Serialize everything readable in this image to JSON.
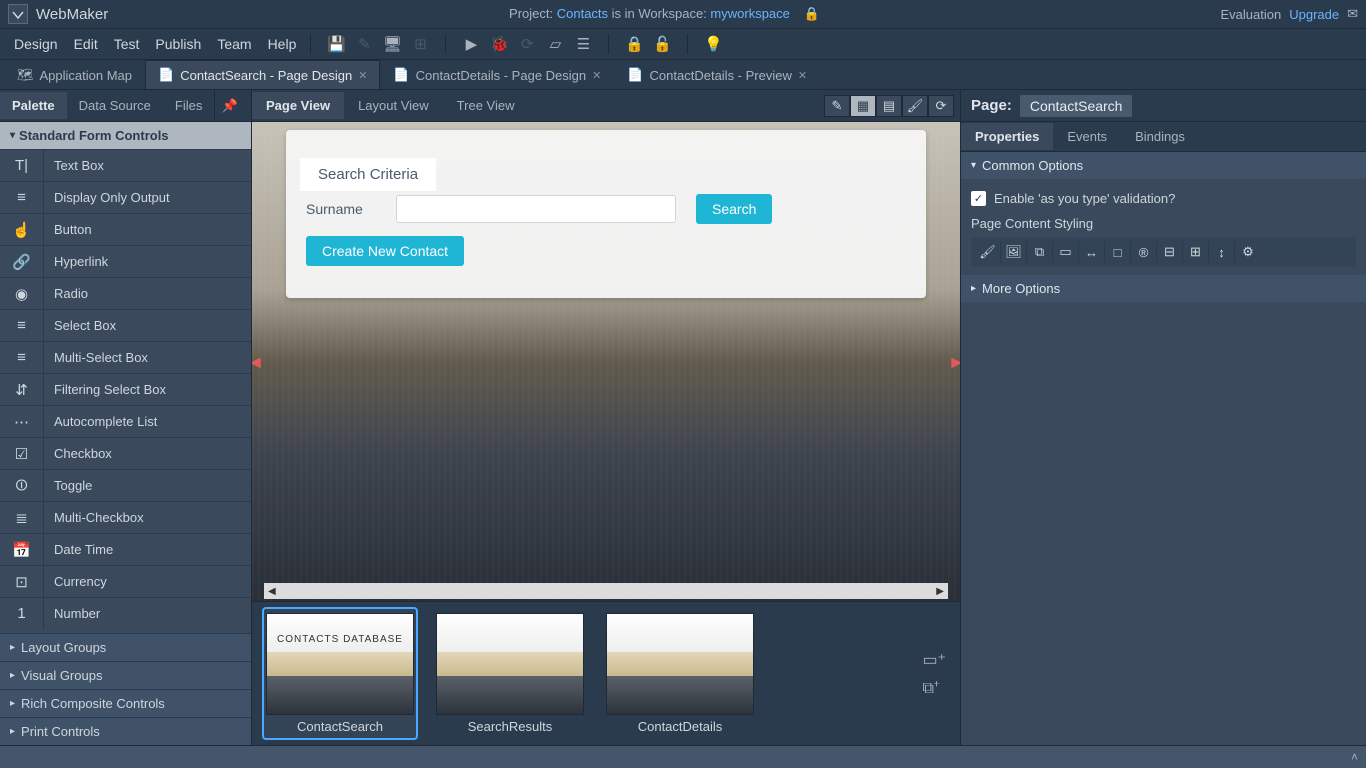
{
  "titlebar": {
    "app_name": "WebMaker",
    "project_prefix": "Project: ",
    "project_name": "Contacts",
    "workspace_prefix": " is in Workspace: ",
    "workspace_name": "myworkspace",
    "right": {
      "evaluation": "Evaluation",
      "upgrade": "Upgrade"
    }
  },
  "menubar": {
    "items": [
      "Design",
      "Edit",
      "Test",
      "Publish",
      "Team",
      "Help"
    ]
  },
  "file_tabs": {
    "items": [
      {
        "label": "Application Map",
        "icon": "map",
        "closable": false,
        "active": false
      },
      {
        "label": "ContactSearch - Page Design",
        "icon": "page",
        "closable": true,
        "active": true
      },
      {
        "label": "ContactDetails - Page Design",
        "icon": "page",
        "closable": true,
        "active": false
      },
      {
        "label": "ContactDetails - Preview",
        "icon": "page",
        "closable": true,
        "active": false
      }
    ]
  },
  "left_tabs": {
    "items": [
      "Palette",
      "Data Source",
      "Files"
    ],
    "active_index": 0
  },
  "palette": {
    "groups": [
      {
        "label": "Standard Form Controls",
        "expanded": true,
        "items": [
          {
            "label": "Text Box",
            "icon": "T|"
          },
          {
            "label": "Display Only Output",
            "icon": "≡"
          },
          {
            "label": "Button",
            "icon": "☝"
          },
          {
            "label": "Hyperlink",
            "icon": "🔗"
          },
          {
            "label": "Radio",
            "icon": "◉"
          },
          {
            "label": "Select Box",
            "icon": "≡"
          },
          {
            "label": "Multi-Select Box",
            "icon": "≡"
          },
          {
            "label": "Filtering Select Box",
            "icon": "⇵"
          },
          {
            "label": "Autocomplete List",
            "icon": "⋯"
          },
          {
            "label": "Checkbox",
            "icon": "☑"
          },
          {
            "label": "Toggle",
            "icon": "⏼"
          },
          {
            "label": "Multi-Checkbox",
            "icon": "≣"
          },
          {
            "label": "Date Time",
            "icon": "📅"
          },
          {
            "label": "Currency",
            "icon": "⊡"
          },
          {
            "label": "Number",
            "icon": "1"
          }
        ]
      },
      {
        "label": "Layout Groups",
        "expanded": false,
        "items": []
      },
      {
        "label": "Visual Groups",
        "expanded": false,
        "items": []
      },
      {
        "label": "Rich Composite Controls",
        "expanded": false,
        "items": []
      },
      {
        "label": "Print Controls",
        "expanded": false,
        "items": []
      }
    ]
  },
  "center_tabs": {
    "items": [
      "Page View",
      "Layout View",
      "Tree View"
    ],
    "active_index": 0
  },
  "preview": {
    "group_title": "Search Criteria",
    "surname_label": "Surname",
    "surname_value": "",
    "search_btn": "Search",
    "create_btn": "Create New Contact"
  },
  "thumbs": {
    "items": [
      {
        "name": "ContactSearch",
        "heading": "CONTACTS DATABASE",
        "active": true
      },
      {
        "name": "SearchResults",
        "heading": "",
        "active": false
      },
      {
        "name": "ContactDetails",
        "heading": "",
        "active": false
      }
    ]
  },
  "right": {
    "page_label": "Page:",
    "page_name": "ContactSearch",
    "tabs": [
      "Properties",
      "Events",
      "Bindings"
    ],
    "active_tab": 0,
    "sections": {
      "common_options": "Common Options",
      "enable_validation": "Enable 'as you type' validation?",
      "styling_label": "Page Content Styling",
      "more_options": "More Options"
    }
  }
}
